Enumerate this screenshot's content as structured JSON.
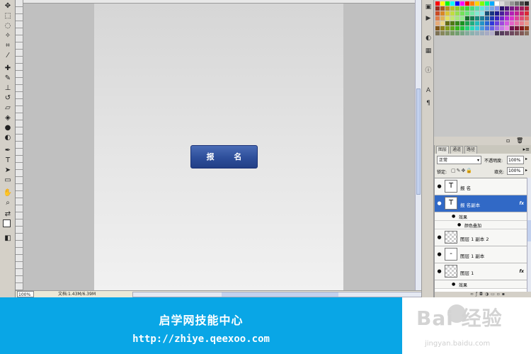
{
  "canvas": {
    "button_text": "报 名"
  },
  "statusbar": {
    "zoom": "100%",
    "doc_size": "文档:1.43M/6.39M"
  },
  "layers_panel": {
    "tabs": [
      "图层",
      "通道",
      "路径"
    ],
    "blend_mode": "正常",
    "opacity_label": "不透明度:",
    "opacity_value": "100%",
    "lock_label": "锁定:",
    "fill_label": "填充:",
    "fill_value": "100%",
    "layers": [
      {
        "name": "报 名",
        "thumb": "T",
        "selected": false
      },
      {
        "name": "报 名副本",
        "thumb": "T",
        "selected": true,
        "fx": "fx"
      },
      {
        "effects_label": "效果",
        "effect_item": "颜色叠加"
      },
      {
        "name": "图层 1 副本 2",
        "thumb": "",
        "selected": false
      },
      {
        "name": "图层 1 副本",
        "thumb": "-",
        "selected": false
      },
      {
        "name": "图层 1",
        "thumb": "",
        "selected": false,
        "fx": "fx"
      },
      {
        "effects_label": "效果"
      }
    ]
  },
  "banner": {
    "title": "启学网技能中心",
    "url": "http://zhiye.qeexoo.com"
  },
  "watermark": {
    "logo_text": "Bai 经验",
    "url": "jingyan.baidu.com"
  },
  "colors": {
    "banner_bg": "#09a6e6",
    "selected_layer": "#3169c6",
    "button_blue": "#2d4e9a"
  }
}
